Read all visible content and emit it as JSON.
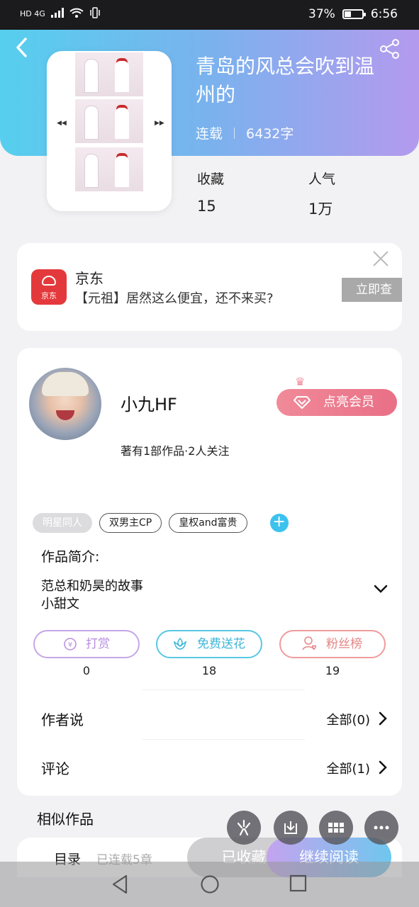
{
  "status_bar": {
    "network": "HD 4G",
    "battery_percent": "37%",
    "battery_level": 0.37,
    "time": "6:56"
  },
  "header": {
    "book_title": "青岛的风总会吹到温州的",
    "status": "连载",
    "word_count": "6432字",
    "stats": [
      {
        "label": "收藏",
        "value": "15"
      },
      {
        "label": "人气",
        "value": "1万"
      }
    ]
  },
  "ad": {
    "brand": "京东",
    "logo_text": "京东",
    "description": "【元祖】居然这么便宜，还不来买?",
    "cta": "立即查",
    "close_icon": "close-icon"
  },
  "author": {
    "name": "小九HF",
    "meta": "著有1部作品·2人关注",
    "vip_label": "点亮会员"
  },
  "tags": [
    "明星同人",
    "双男主CP",
    "皇权and富贵"
  ],
  "intro": {
    "title": "作品简介:",
    "lines": [
      "范总和奶昊的故事",
      "小甜文"
    ]
  },
  "actions": [
    {
      "label": "打赏",
      "count": "0",
      "color": "#b78ee0",
      "icon": "yen-icon"
    },
    {
      "label": "免费送花",
      "count": "18",
      "color": "#3fc3e0",
      "icon": "flower-icon"
    },
    {
      "label": "粉丝榜",
      "count": "19",
      "color": "#ec8d8d",
      "icon": "fan-icon"
    }
  ],
  "sections": [
    {
      "label": "作者说",
      "link": "全部(0)"
    },
    {
      "label": "评论",
      "link": "全部(1)"
    }
  ],
  "similar_title": "相似作品",
  "bottom_bar": {
    "toc_label": "目录",
    "toc_meta": "已连载5章",
    "favorite_label": "已收藏",
    "read_label": "继续阅读"
  },
  "colors": {
    "header_gradient": [
      "#56cfee",
      "#b49aee"
    ],
    "vip": "#ec7a8e",
    "accent_blue": "#3dc2ee"
  }
}
